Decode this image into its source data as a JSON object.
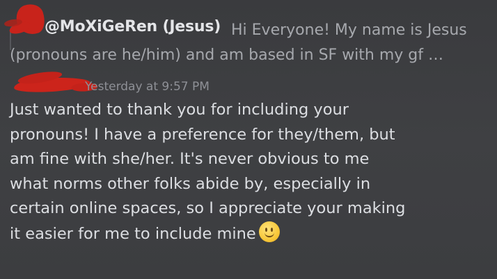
{
  "reply": {
    "author": "@MoXiGeRen (Jesus)",
    "preview": "Hi Everyone! My name is Jesus (pronouns are he/him) and am based in SF  with my gf …"
  },
  "message": {
    "timestamp": "Yesterday at 9:57 PM",
    "lines": [
      "Just wanted to thank you for including your",
      "pronouns! I have a preference for they/them, but",
      "am fine with she/her. It's never obvious to me",
      "what norms other folks abide by, especially in",
      "certain online spaces, so I appreciate your making",
      "it easier for me to include mine"
    ],
    "emoji": "slightly-smiling-face"
  },
  "colors": {
    "background": "#3d3e41",
    "author": "#e4e5e8",
    "preview_text": "#a6a8ad",
    "timestamp": "#8e9096",
    "body_text": "#dcdee2",
    "redaction": "#c8231b"
  }
}
